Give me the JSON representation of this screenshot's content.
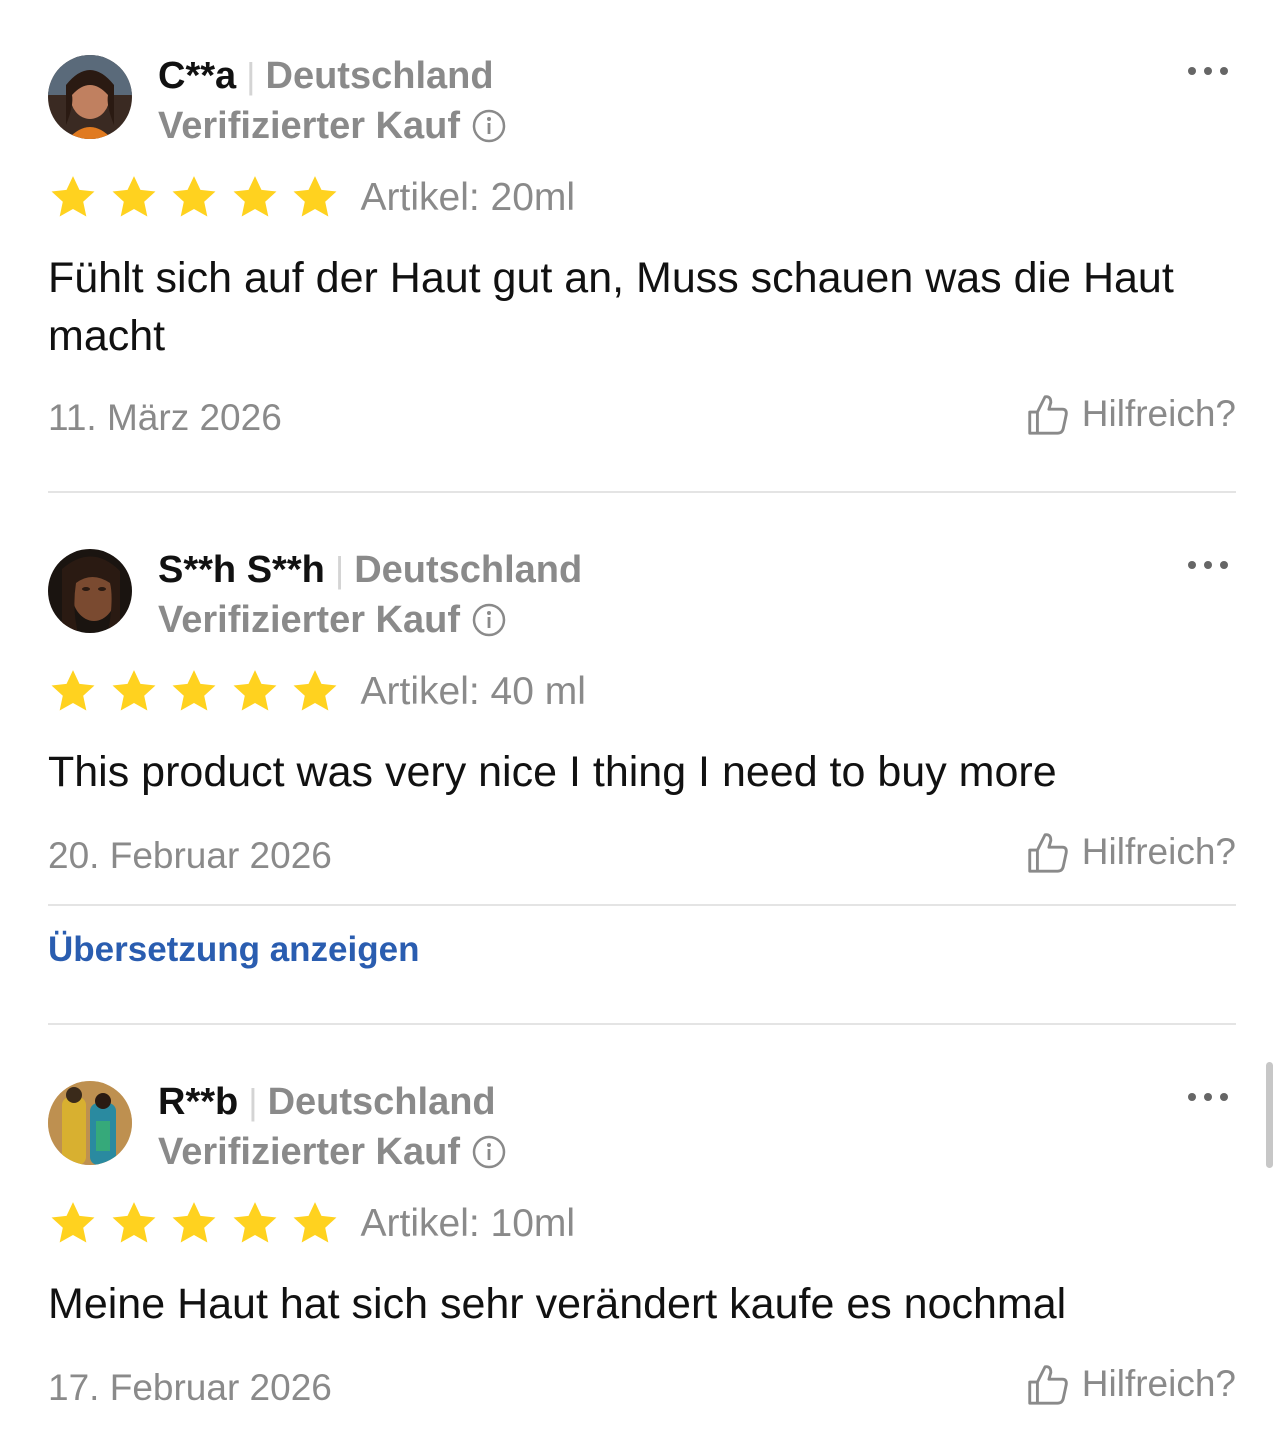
{
  "reviews": [
    {
      "username": "C**a",
      "country": "Deutschland",
      "verified_label": "Verifizierter Kauf",
      "rating": 5,
      "article": "Artikel: 20ml",
      "text": "Fühlt sich auf der Haut gut an, Muss schauen was die Haut macht",
      "date": "11. März 2026",
      "helpful_label": "Hilfreich?"
    },
    {
      "username": "S**h S**h",
      "country": "Deutschland",
      "verified_label": "Verifizierter Kauf",
      "rating": 5,
      "article": "Artikel: 40 ml",
      "text": "This product was very nice I thing I need to buy more",
      "date": "20. Februar 2026",
      "helpful_label": "Hilfreich?",
      "translate_label": "Übersetzung anzeigen"
    },
    {
      "username": "R**b",
      "country": "Deutschland",
      "verified_label": "Verifizierter Kauf",
      "rating": 5,
      "article": "Artikel: 10ml",
      "text": "Meine Haut hat sich sehr verändert kaufe es nochmal",
      "date": "17. Februar 2026",
      "helpful_label": "Hilfreich?"
    }
  ],
  "colors": {
    "star": "#FFD21F",
    "link": "#2A5DB0",
    "muted_text": "#8A8A8A",
    "divider": "#E4E4E4"
  },
  "icons": {
    "more": "more-dots-icon",
    "info": "info-icon",
    "star": "star-icon",
    "helpful": "thumbs-up-icon"
  }
}
